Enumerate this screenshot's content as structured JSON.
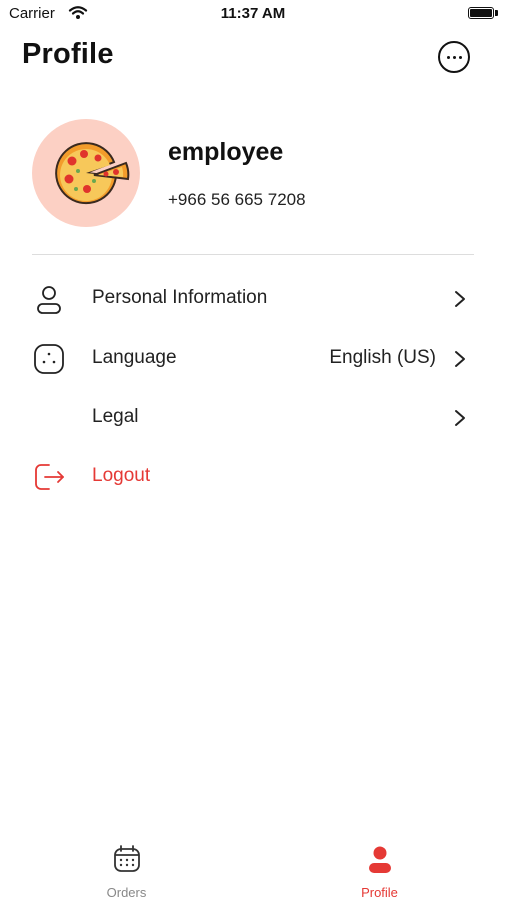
{
  "status_bar": {
    "carrier": "Carrier",
    "time": "11:37 AM"
  },
  "header": {
    "title": "Profile"
  },
  "profile": {
    "name": "employee",
    "phone": "+966 56 665 7208"
  },
  "menu": {
    "personal": {
      "label": "Personal Information",
      "icon": "user-icon"
    },
    "language": {
      "label": "Language",
      "value": "English (US)",
      "icon": "language-icon"
    },
    "legal": {
      "label": "Legal"
    },
    "logout": {
      "label": "Logout",
      "icon": "logout-icon"
    }
  },
  "tabs": [
    {
      "label": "Orders",
      "icon": "calendar-icon",
      "active": false
    },
    {
      "label": "Profile",
      "icon": "person-icon",
      "active": true
    }
  ],
  "colors": {
    "accent": "#e53935",
    "avatar_bg": "#fcd0c4",
    "inactive": "#888888"
  }
}
